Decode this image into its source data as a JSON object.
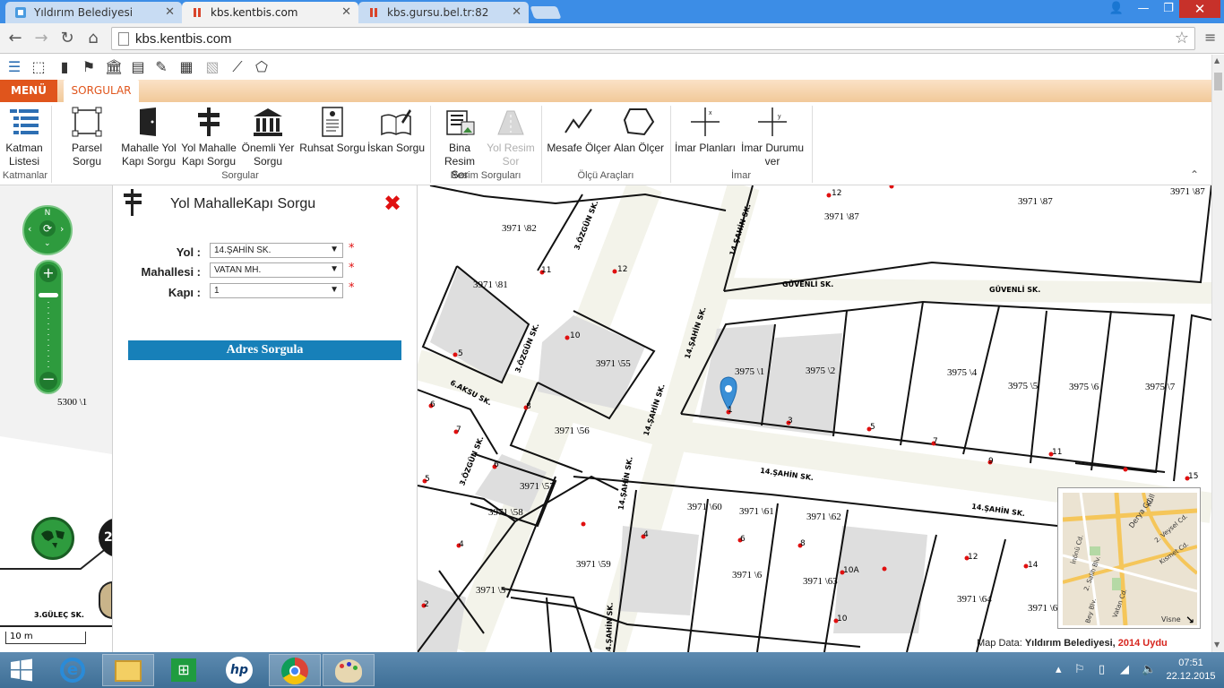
{
  "browser": {
    "tabs": [
      {
        "title": "Yıldırım Belediyesi",
        "state": "inactive"
      },
      {
        "title": "kbs.kentbis.com",
        "state": "active"
      },
      {
        "title": "kbs.gursu.bel.tr:82",
        "state": "inactive"
      }
    ],
    "url": "kbs.kentbis.com"
  },
  "app": {
    "menu_tab": "MENÜ",
    "sorgular_tab": "SORGULAR",
    "ribbon": {
      "katmanlar": {
        "button": "Katman Listesi",
        "group": "Katmanlar"
      },
      "sorgular": {
        "group": "Sorgular",
        "buttons": [
          "Parsel Sorgu",
          "Mahalle Yol Kapı Sorgu",
          "Yol Mahalle Kapı Sorgu",
          "Önemli Yer Sorgu",
          "Ruhsat Sorgu",
          "İskan Sorgu"
        ]
      },
      "resim": {
        "group": "Resim Sorguları",
        "buttons": [
          "Bina Resim Sor",
          "Yol Resim Sor"
        ]
      },
      "olcu": {
        "group": "Ölçü Araçları",
        "buttons": [
          "Mesafe Ölçer",
          "Alan Ölçer"
        ]
      },
      "imar": {
        "group": "İmar",
        "buttons": [
          "İmar Planları",
          "İmar Durumu ver"
        ]
      }
    }
  },
  "panel": {
    "title": "Yol MahalleKapı Sorgu",
    "fields": [
      {
        "label": "Yol :",
        "value": "14.ŞAHİN SK."
      },
      {
        "label": "Mahallesi :",
        "value": "VATAN MH."
      },
      {
        "label": "Kapı :",
        "value": "1"
      }
    ],
    "required_mark": "*",
    "button": "Adres Sorgula"
  },
  "map": {
    "scale": "10 m",
    "parcel_left": "5300 \\1",
    "badge": "2",
    "street_left": "3.GÜLEÇ SK.",
    "parcels": [
      "3971 \\82",
      "3971 \\81",
      "3971 \\55",
      "3971 \\56",
      "3971 \\57",
      "3971 \\58",
      "3971 \\59",
      "3971 \\5",
      "3971 \\60",
      "3971 \\61",
      "3971 \\62",
      "3971 \\6",
      "3971 \\63",
      "3971 \\64",
      "3971 \\87",
      "3975 \\1",
      "3975 \\2",
      "3975 \\4",
      "3975 \\5",
      "3975 \\6",
      "3975 \\7",
      "3971 \\6",
      "3971 \\8"
    ],
    "door_numbers": [
      "12",
      "11",
      "12",
      "10",
      "5",
      "6",
      "8",
      "7",
      "6",
      "5",
      "4",
      "2",
      "1",
      "3",
      "5",
      "7",
      "9",
      "11",
      "15",
      "4",
      "6",
      "8",
      "10A",
      "10",
      "12",
      "14",
      "18",
      "6"
    ],
    "streets": [
      "3.ÖZGÜN SK.",
      "14.ŞAHİN SK.",
      "GÜVENLİ SK.",
      "GÜVENLİ SK.",
      "3.ÖZGÜN SK.",
      "14.ŞAHİN SK.",
      "6.AKSU SK.",
      "14.ŞAHİN SK.",
      "3.ÖZGÜN SK.",
      "14.ŞAHİN SK.",
      "14.ŞAHİN SK.",
      "14.ŞAHİN SK.",
      "14.ŞAHİN SK."
    ],
    "map_data_label": "Map Data:",
    "map_data_owner": "Yıldırım Belediyesi,",
    "map_data_year": "2014 Uydu",
    "minimap_labels": [
      "Küll",
      "Derya Cd.",
      "2. Veysel Cd.",
      "Kısmet Cd.",
      "İnönü Cd.",
      "2. Salih Blv.",
      "Vatan Cd.",
      "Visne",
      "Bey Blv."
    ]
  },
  "taskbar": {
    "time": "07:51",
    "date": "22.12.2015"
  }
}
